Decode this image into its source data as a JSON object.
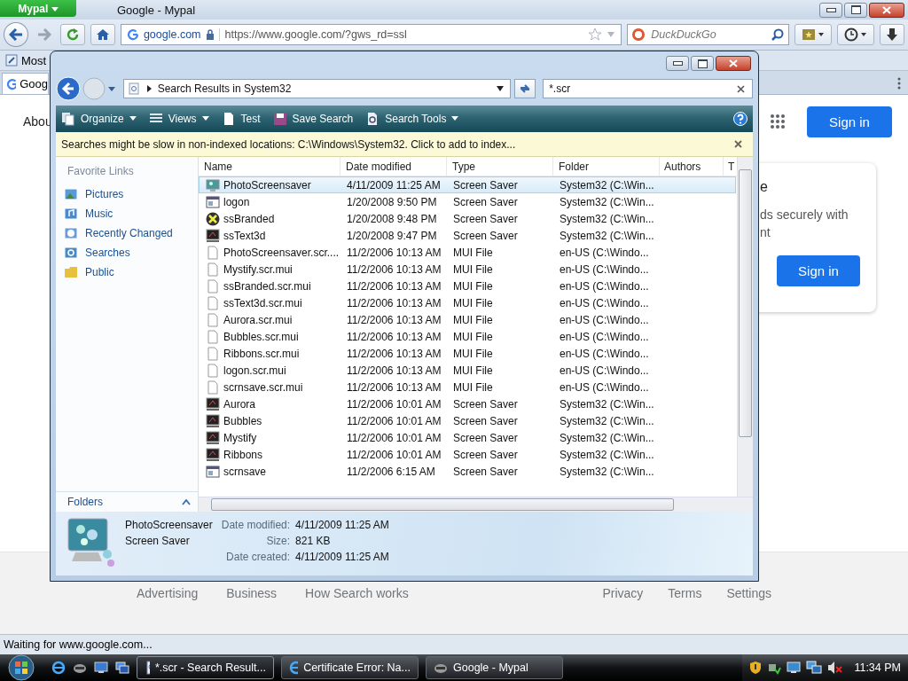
{
  "browser": {
    "menu_button": "Mypal",
    "title": "Google - Mypal",
    "url_identity": "google.com",
    "url": "https://www.google.com/?gws_rd=ssl",
    "search_placeholder": "DuckDuckGo",
    "bookmark": "Most",
    "tab": "Goog"
  },
  "google": {
    "about": "Abou",
    "sign_in": "Sign in",
    "card_title": "e",
    "card_lines": [
      "ds securely with",
      "nt"
    ],
    "card_button": "Sign in",
    "footer_left": [
      "Advertising",
      "Business",
      "How Search works"
    ],
    "footer_right": [
      "Privacy",
      "Terms",
      "Settings"
    ]
  },
  "status_bar": "Waiting for www.google.com...",
  "explorer": {
    "address": "Search Results in System32",
    "search_value": "*.scr",
    "toolbar": [
      {
        "label": "Organize",
        "kind": "organize",
        "menu": true
      },
      {
        "label": "Views",
        "kind": "views",
        "menu": true
      },
      {
        "label": "Test",
        "kind": "test",
        "menu": false
      },
      {
        "label": "Save Search",
        "kind": "save",
        "menu": false
      },
      {
        "label": "Search Tools",
        "kind": "tools",
        "menu": true
      }
    ],
    "info_bar": "Searches might be slow in non-indexed locations: C:\\Windows\\System32. Click to add to index...",
    "favorites_heading": "Favorite Links",
    "favorites": [
      {
        "label": "Pictures",
        "kind": "pictures"
      },
      {
        "label": "Music",
        "kind": "music"
      },
      {
        "label": "Recently Changed",
        "kind": "recent"
      },
      {
        "label": "Searches",
        "kind": "searches"
      },
      {
        "label": "Public",
        "kind": "folder"
      }
    ],
    "folders": "Folders",
    "columns": [
      "Name",
      "Date modified",
      "Type",
      "Folder",
      "Authors",
      "T"
    ],
    "rows": [
      {
        "name": "PhotoScreensaver",
        "date": "4/11/2009 11:25 AM",
        "type": "Screen Saver",
        "folder": "System32 (C:\\Win...",
        "kind": "photo",
        "selected": true
      },
      {
        "name": "logon",
        "date": "1/20/2008 9:50 PM",
        "type": "Screen Saver",
        "folder": "System32 (C:\\Win...",
        "kind": "window",
        "selected": false
      },
      {
        "name": "ssBranded",
        "date": "1/20/2008 9:48 PM",
        "type": "Screen Saver",
        "folder": "System32 (C:\\Win...",
        "kind": "branded",
        "selected": false
      },
      {
        "name": "ssText3d",
        "date": "1/20/2008 9:47 PM",
        "type": "Screen Saver",
        "folder": "System32 (C:\\Win...",
        "kind": "monitor",
        "selected": false
      },
      {
        "name": "PhotoScreensaver.scr....",
        "date": "11/2/2006 10:13 AM",
        "type": "MUI File",
        "folder": "en-US (C:\\Windo...",
        "kind": "file",
        "selected": false
      },
      {
        "name": "Mystify.scr.mui",
        "date": "11/2/2006 10:13 AM",
        "type": "MUI File",
        "folder": "en-US (C:\\Windo...",
        "kind": "file",
        "selected": false
      },
      {
        "name": "ssBranded.scr.mui",
        "date": "11/2/2006 10:13 AM",
        "type": "MUI File",
        "folder": "en-US (C:\\Windo...",
        "kind": "file",
        "selected": false
      },
      {
        "name": "ssText3d.scr.mui",
        "date": "11/2/2006 10:13 AM",
        "type": "MUI File",
        "folder": "en-US (C:\\Windo...",
        "kind": "file",
        "selected": false
      },
      {
        "name": "Aurora.scr.mui",
        "date": "11/2/2006 10:13 AM",
        "type": "MUI File",
        "folder": "en-US (C:\\Windo...",
        "kind": "file",
        "selected": false
      },
      {
        "name": "Bubbles.scr.mui",
        "date": "11/2/2006 10:13 AM",
        "type": "MUI File",
        "folder": "en-US (C:\\Windo...",
        "kind": "file",
        "selected": false
      },
      {
        "name": "Ribbons.scr.mui",
        "date": "11/2/2006 10:13 AM",
        "type": "MUI File",
        "folder": "en-US (C:\\Windo...",
        "kind": "file",
        "selected": false
      },
      {
        "name": "logon.scr.mui",
        "date": "11/2/2006 10:13 AM",
        "type": "MUI File",
        "folder": "en-US (C:\\Windo...",
        "kind": "file",
        "selected": false
      },
      {
        "name": "scrnsave.scr.mui",
        "date": "11/2/2006 10:13 AM",
        "type": "MUI File",
        "folder": "en-US (C:\\Windo...",
        "kind": "file",
        "selected": false
      },
      {
        "name": "Aurora",
        "date": "11/2/2006 10:01 AM",
        "type": "Screen Saver",
        "folder": "System32 (C:\\Win...",
        "kind": "monitor",
        "selected": false
      },
      {
        "name": "Bubbles",
        "date": "11/2/2006 10:01 AM",
        "type": "Screen Saver",
        "folder": "System32 (C:\\Win...",
        "kind": "monitor",
        "selected": false
      },
      {
        "name": "Mystify",
        "date": "11/2/2006 10:01 AM",
        "type": "Screen Saver",
        "folder": "System32 (C:\\Win...",
        "kind": "monitor",
        "selected": false
      },
      {
        "name": "Ribbons",
        "date": "11/2/2006 10:01 AM",
        "type": "Screen Saver",
        "folder": "System32 (C:\\Win...",
        "kind": "monitor",
        "selected": false
      },
      {
        "name": "scrnsave",
        "date": "11/2/2006 6:15 AM",
        "type": "Screen Saver",
        "folder": "System32 (C:\\Win...",
        "kind": "window",
        "selected": false
      }
    ],
    "details": {
      "name": "PhotoScreensaver",
      "type": "Screen Saver",
      "fields": [
        {
          "label": "Date modified:",
          "value": "4/11/2009 11:25 AM"
        },
        {
          "label": "Size:",
          "value": "821 KB"
        },
        {
          "label": "Date created:",
          "value": "4/11/2009 11:25 AM"
        }
      ]
    }
  },
  "taskbar": {
    "tasks": [
      {
        "label": "*.scr - Search Result...",
        "kind": "search",
        "selected": true
      },
      {
        "label": "Certificate Error: Na...",
        "kind": "ie",
        "selected": false
      },
      {
        "label": "Google - Mypal",
        "kind": "mypal",
        "selected": false
      }
    ],
    "clock": "11:34 PM"
  }
}
